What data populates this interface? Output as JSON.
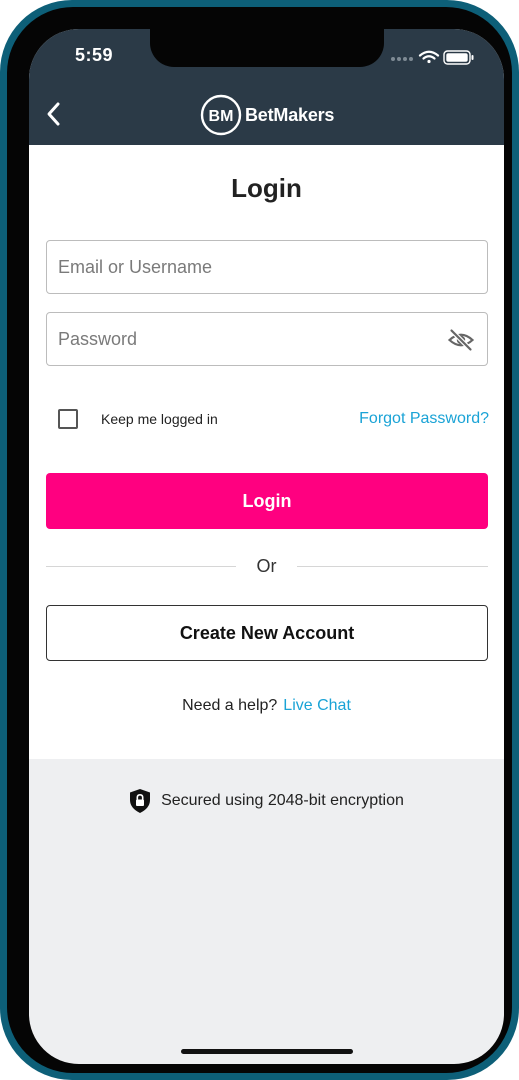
{
  "status_bar": {
    "time": "5:59"
  },
  "header": {
    "brand_name": "BetMakers",
    "back_icon": "chevron-left-icon"
  },
  "login": {
    "title": "Login",
    "email_placeholder": "Email or Username",
    "password_placeholder": "Password",
    "keep_logged_in_label": "Keep me logged in",
    "forgot_password": "Forgot Password?",
    "login_button": "Login",
    "or_text": "Or",
    "create_account_button": "Create New Account",
    "help_text": "Need a help?",
    "live_chat": "Live Chat"
  },
  "security": {
    "text": "Secured using 2048-bit encryption",
    "icon": "shield-lock-icon"
  },
  "colors": {
    "frame": "#0d5f78",
    "header": "#2b3a47",
    "primary": "#ff0080",
    "link": "#1aa3d6",
    "footer_bg": "#eeeff1"
  }
}
